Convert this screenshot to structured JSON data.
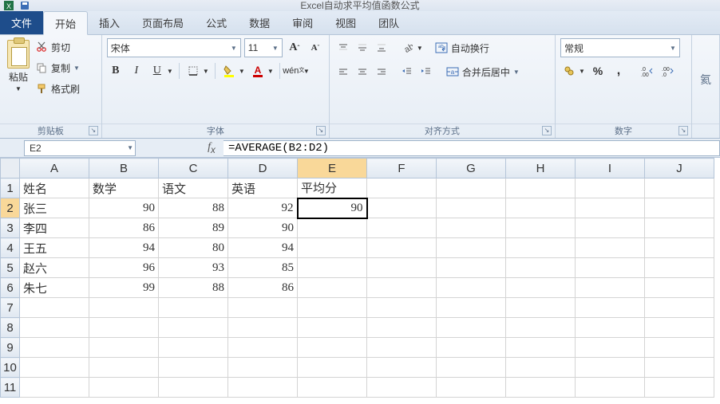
{
  "title": "Excel自动求平均值函数公式",
  "tabs": {
    "file": "文件",
    "items": [
      "开始",
      "插入",
      "页面布局",
      "公式",
      "数据",
      "审阅",
      "视图",
      "团队"
    ],
    "active": 0
  },
  "clipboard": {
    "paste": "粘贴",
    "cut": "剪切",
    "copy": "复制",
    "format_painter": "格式刷",
    "group_label": "剪贴板"
  },
  "font": {
    "name": "宋体",
    "size": "11",
    "bold": "B",
    "italic": "I",
    "underline": "U",
    "group_label": "字体"
  },
  "alignment": {
    "wrap": "自动换行",
    "merge": "合并后居中",
    "group_label": "对齐方式"
  },
  "number": {
    "format": "常规",
    "percent": "%",
    "comma": ",",
    "group_label": "数字"
  },
  "namebox": "E2",
  "formula": "=AVERAGE(B2:D2)",
  "columns": [
    "A",
    "B",
    "C",
    "D",
    "E",
    "F",
    "G",
    "H",
    "I",
    "J"
  ],
  "headers": [
    "姓名",
    "数学",
    "语文",
    "英语",
    "平均分"
  ],
  "chart_data": {
    "type": "table",
    "columns": [
      "姓名",
      "数学",
      "语文",
      "英语",
      "平均分"
    ],
    "rows": [
      {
        "name": "张三",
        "math": 90,
        "chinese": 88,
        "english": 92,
        "avg": 90
      },
      {
        "name": "李四",
        "math": 86,
        "chinese": 89,
        "english": 90,
        "avg": null
      },
      {
        "name": "王五",
        "math": 94,
        "chinese": 80,
        "english": 94,
        "avg": null
      },
      {
        "name": "赵六",
        "math": 96,
        "chinese": 93,
        "english": 85,
        "avg": null
      },
      {
        "name": "朱七",
        "math": 99,
        "chinese": 88,
        "english": 86,
        "avg": null
      }
    ]
  },
  "active_cell": {
    "row": 2,
    "col": "E"
  }
}
